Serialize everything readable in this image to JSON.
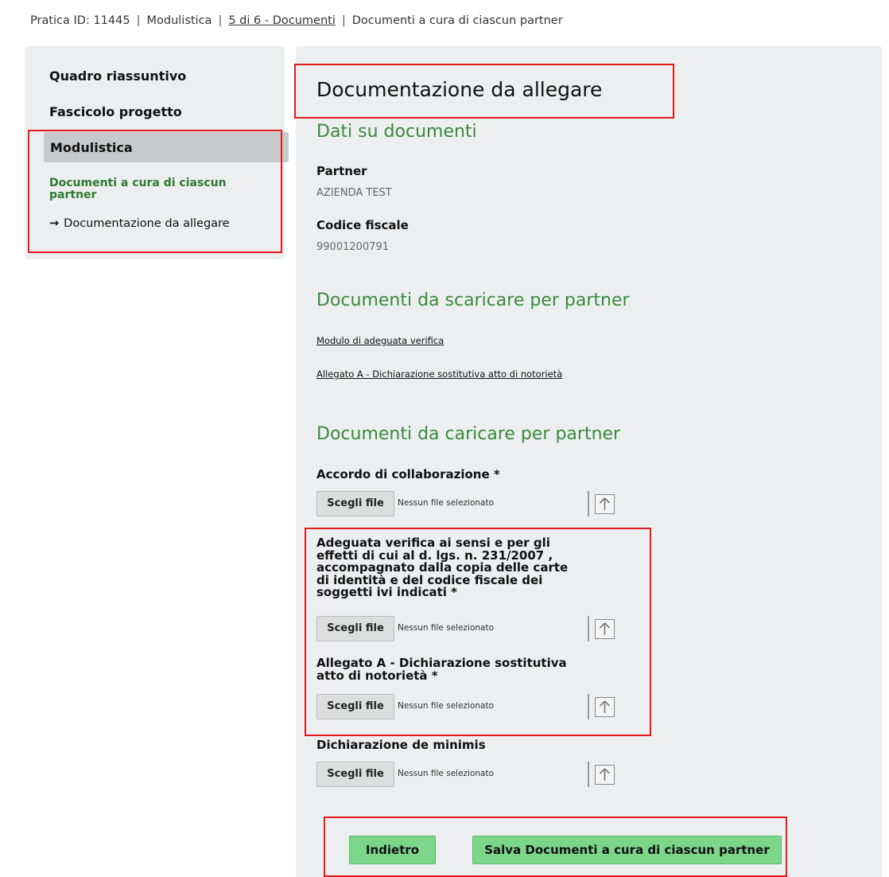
{
  "breadcrumb": {
    "pratica": "Pratica ID: 11445",
    "section": "Modulistica",
    "step": "5 di 6 - Documenti",
    "current": "Documenti a cura di ciascun partner",
    "separator": "|"
  },
  "sidebar": {
    "items": [
      "Quadro riassuntivo",
      "Fascicolo progetto"
    ],
    "active": "Modulistica",
    "sub": "Documenti a cura di ciascun partner",
    "subsub_arrow": "→",
    "subsub": "Documentazione da allegare"
  },
  "main": {
    "title": "Documentazione da allegare",
    "dati_heading": "Dati su documenti",
    "partner_label": "Partner",
    "partner_value": "AZIENDA TEST",
    "cf_label": "Codice fiscale",
    "cf_value": "99001200791",
    "download_heading": "Documenti da scaricare per partner",
    "downloads": [
      "Modulo di adeguata verifica",
      "Allegato A - Dichiarazione sostitutiva atto di notorietà"
    ],
    "upload_heading": "Documenti da caricare per partner",
    "uploads": [
      {
        "label": "Accordo di collaborazione *",
        "button": "Scegli file",
        "status": "Nessun file selezionato"
      },
      {
        "label": "Adeguata verifica ai sensi e per gli effetti di cui al d. lgs. n. 231/2007 , accompagnato dalla copia delle carte di identità e del codice fiscale dei soggetti ivi indicati *",
        "button": "Scegli file",
        "status": "Nessun file selezionato"
      },
      {
        "label": "Allegato A - Dichiarazione sostitutiva atto di notorietà *",
        "button": "Scegli file",
        "status": "Nessun file selezionato"
      },
      {
        "label": "Dichiarazione de minimis",
        "button": "Scegli file",
        "status": "Nessun file selezionato"
      }
    ],
    "back_button": "Indietro",
    "save_button": "Salva Documenti a cura di ciascun partner"
  },
  "colors": {
    "accent_green": "#3a8a3e",
    "button_green": "#7cd68a",
    "highlight_red": "#e31a1a"
  }
}
